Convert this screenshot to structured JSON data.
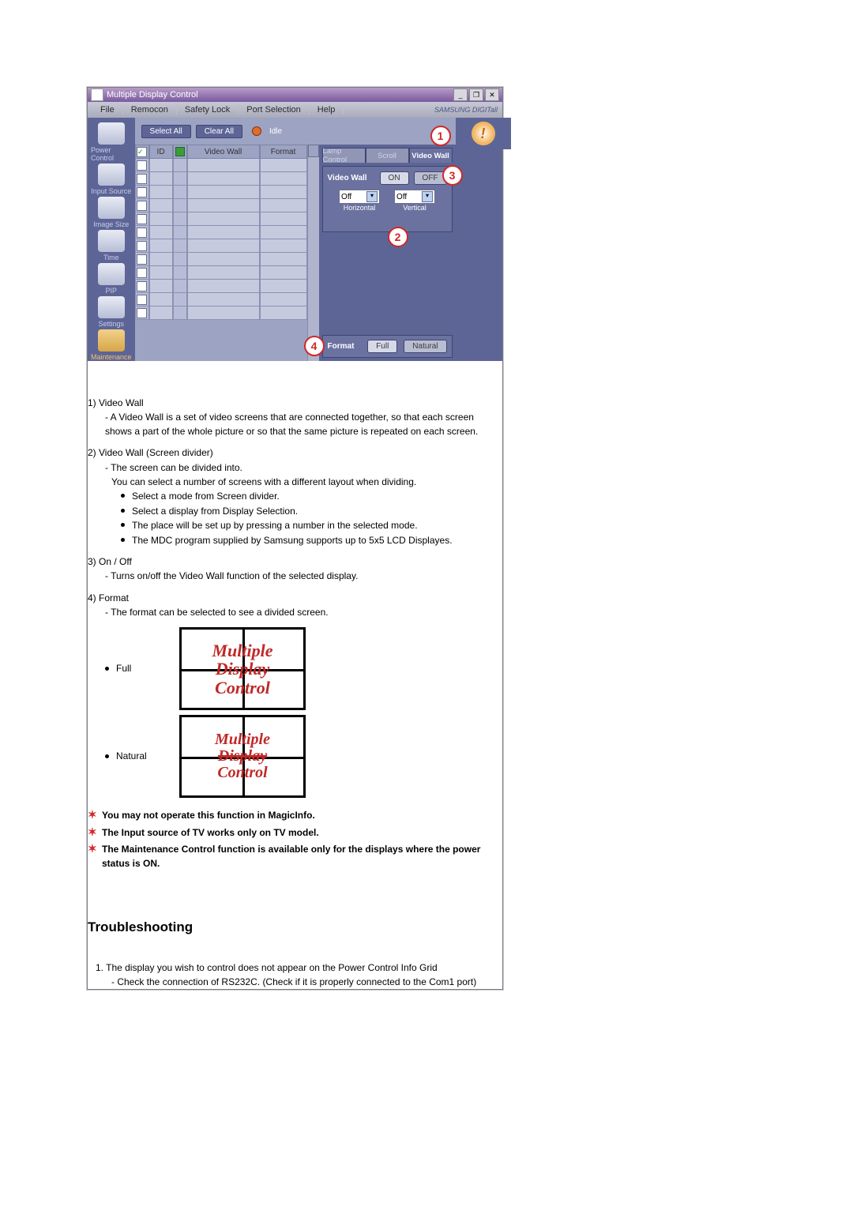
{
  "app": {
    "title": "Multiple Display Control",
    "brand": "SAMSUNG DIGITall",
    "minimize": "_",
    "restore": "❐",
    "close": "✕"
  },
  "menu": {
    "file": "File",
    "remocon": "Remocon",
    "safety": "Safety Lock",
    "port": "Port Selection",
    "help": "Help"
  },
  "sidebar": {
    "items": [
      {
        "label": "Power Control"
      },
      {
        "label": "Input Source"
      },
      {
        "label": "Image Size"
      },
      {
        "label": "Time"
      },
      {
        "label": "PIP"
      },
      {
        "label": "Settings"
      },
      {
        "label": "Maintenance"
      }
    ]
  },
  "toolbar": {
    "select_all": "Select All",
    "clear_all": "Clear All",
    "idle": "Idle"
  },
  "grid": {
    "col_id": "ID",
    "col_vw": "Video Wall",
    "col_fmt": "Format"
  },
  "tabs": {
    "lamp": "Lamp Control",
    "scroll": "Scroll",
    "videowall": "Video Wall"
  },
  "panel": {
    "vw_label": "Video Wall",
    "on": "ON",
    "off": "OFF",
    "sel_off": "Off",
    "horizontal": "Horizontal",
    "vertical": "Vertical",
    "format": "Format",
    "full": "Full",
    "natural": "Natural"
  },
  "callouts": {
    "c1": "1",
    "c2": "2",
    "c3": "3",
    "c4": "4"
  },
  "doc": {
    "i1_head": "1)  Video Wall",
    "i1_sub": "- A Video Wall is a set of video screens that are connected together, so that each screen shows a part of the whole picture or so that the same picture is repeated on each screen.",
    "i2_head": "2)  Video Wall (Screen divider)",
    "i2_sub1": "- The screen can be divided into.",
    "i2_sub2": "You can select a number of screens with a different layout when dividing.",
    "i2_b1": "Select a mode from Screen divider.",
    "i2_b2": "Select a display from Display Selection.",
    "i2_b3": "The place will be set up by pressing a number in the selected mode.",
    "i2_b4": "The MDC program supplied by Samsung supports up to 5x5 LCD Displayes.",
    "i3_head": "3)  On / Off",
    "i3_sub": "- Turns on/off the Video Wall function of the selected display.",
    "i4_head": "4)  Format",
    "i4_sub": "- The format can be selected to see a divided screen.",
    "ft_full": "Full",
    "ft_natural": "Natural",
    "mdc_l1": "Multiple",
    "mdc_l2": "Display",
    "mdc_l3": "Control",
    "note1": "You may not operate this function in MagicInfo.",
    "note2": "The Input source of TV works only on TV model.",
    "note3": "The Maintenance Control function is available only for the displays where the power status is ON.",
    "trbl_head": "Troubleshooting",
    "t1": "1. The display you wish to control does not appear on the Power Control Info Grid",
    "t1_sub": "- Check the connection of RS232C. (Check if it is properly connected to the Com1 port)"
  }
}
